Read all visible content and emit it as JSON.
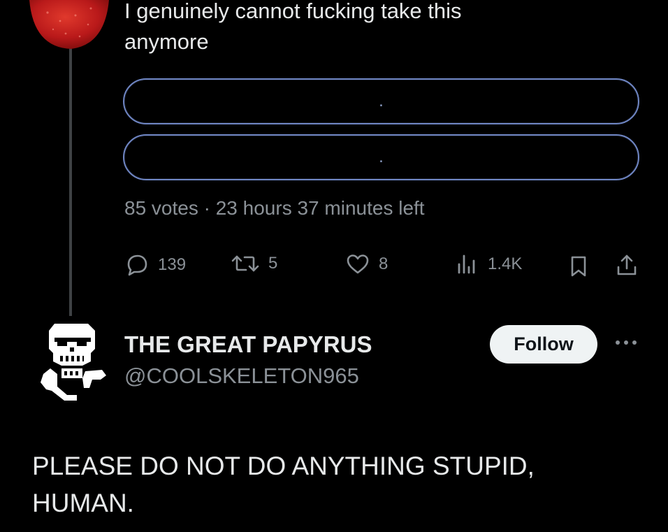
{
  "tweet": {
    "text_line1": "I genuinely cannot fucking take this",
    "text_line2": "anymore"
  },
  "poll": {
    "options": [
      {
        "label": "."
      },
      {
        "label": "."
      }
    ],
    "meta": "85 votes · 23 hours 37 minutes left"
  },
  "actions": {
    "reply_count": "139",
    "retweet_count": "5",
    "like_count": "8",
    "views_count": "1.4K",
    "icons": [
      "reply-icon",
      "retweet-icon",
      "heart-icon",
      "views-icon",
      "bookmark-icon",
      "share-icon"
    ]
  },
  "reply": {
    "display_name": "THE GREAT PAPYRUS",
    "handle": "@COOLSKELETON965",
    "follow_label": "Follow",
    "text_line1": "PLEASE DO NOT DO ANYTHING STUPID,",
    "text_line2": "HUMAN."
  },
  "colors": {
    "background": "#000000",
    "text": "#e7e9ea",
    "muted": "#8b9197",
    "poll_border": "#6f86c4",
    "follow_bg": "#eff3f4",
    "avatar_red": "#c8201a"
  }
}
